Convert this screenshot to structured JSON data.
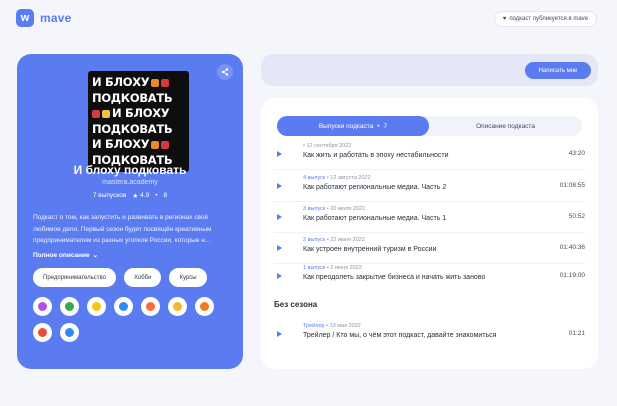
{
  "app": {
    "logo_letter": "w",
    "logo_text": "mave"
  },
  "top_badge": {
    "text": "подкаст публикуется в mave"
  },
  "podcast": {
    "cover_lines": [
      "И БЛОХУ",
      "ПОДКОВАТЬ",
      "И БЛОХУ",
      "ПОДКОВАТЬ",
      "И БЛОХУ",
      "ПОДКОВАТЬ"
    ],
    "title": "И блоху подковать",
    "author": "mastera.academy",
    "episodes_count": "7 выпусков",
    "rating": "4.9",
    "rating_count": "8",
    "description": "Подкаст о том, как запустить и развивать в регионах своё любимое дело. Первый сезон будет посвящён креативным предпринимателям из разных уголков России, которые н...",
    "more_label": "Полное описание",
    "tags": [
      "Предпринимательство",
      "Хобби",
      "Курсы"
    ],
    "platforms": [
      {
        "icon": "apple-podcasts-icon",
        "color": "#b150e2"
      },
      {
        "icon": "google-podcasts-icon",
        "color": "#34a853"
      },
      {
        "icon": "yandex-music-icon",
        "color": "#f5c518"
      },
      {
        "icon": "castbox-icon",
        "color": "#2f8af5"
      },
      {
        "icon": "vk-icon",
        "color": "#ff6a3d"
      },
      {
        "icon": "sberzvuk-icon",
        "color": "#f7b733"
      },
      {
        "icon": "pocket-casts-icon",
        "color": "#f4792b"
      },
      {
        "icon": "podcast-addict-icon",
        "color": "#e94b3c"
      },
      {
        "icon": "rss-icon",
        "color": "#2f8af5"
      }
    ]
  },
  "write_button": "Написать мне",
  "tabs": {
    "episodes_label": "Выпуски подкаста",
    "episodes_count": "7",
    "description_label": "Описание подкаста"
  },
  "episodes": [
    {
      "num": "",
      "date": "12 сентября 2022",
      "title": "Как жить и работать в эпоху нестабильности",
      "duration": "43:20"
    },
    {
      "num": "4 выпуск",
      "date": "12 августа 2022",
      "title": "Как работают региональные медиа. Часть 2",
      "duration": "01:08:55"
    },
    {
      "num": "3 выпуск",
      "date": "20 июля 2022",
      "title": "Как работают региональные медиа. Часть 1",
      "duration": "50:52"
    },
    {
      "num": "2 выпуск",
      "date": "22 июня 2022",
      "title": "Как устроен внутренний туризм в России",
      "duration": "01:40:36"
    },
    {
      "num": "1 выпуск",
      "date": "2 июня 2022",
      "title": "Как преодолеть закрытие бизнеса и начать жить заново",
      "duration": "01:19:00"
    }
  ],
  "no_season": {
    "title": "Без сезона",
    "episodes": [
      {
        "num": "Трейлер",
        "date": "13 мая 2022",
        "title": "Трейлер / Кто мы, о чём этот подкаст, давайте знакомиться",
        "duration": "01:21"
      }
    ]
  }
}
